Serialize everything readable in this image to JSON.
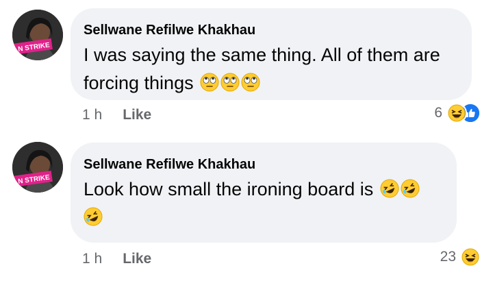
{
  "comments": [
    {
      "author": "Sellwane Refilwe Khakhau",
      "avatar_badge": "N STRIKE",
      "text_line1": "I was saying the same thing. All of them are",
      "text_line2": "forcing things",
      "emojis": [
        "rolling-eyes",
        "rolling-eyes",
        "rolling-eyes"
      ],
      "time": "1 h",
      "like_label": "Like",
      "reaction_count": "6",
      "reactions": [
        "laughing",
        "like"
      ]
    },
    {
      "author": "Sellwane Refilwe Khakhau",
      "avatar_badge": "N STRIKE",
      "text_line1": "Look how small the ironing board is",
      "emojis": [
        "rofl",
        "rofl",
        "rofl"
      ],
      "time": "1 h",
      "like_label": "Like",
      "reaction_count": "23",
      "reactions": [
        "laughing"
      ]
    }
  ],
  "colors": {
    "bubble": "#f0f2f5",
    "meta_text": "#65676b",
    "like_blue": "#1877f2",
    "emoji_yellow": "#ffcc33",
    "badge_pink": "#e0218a"
  }
}
